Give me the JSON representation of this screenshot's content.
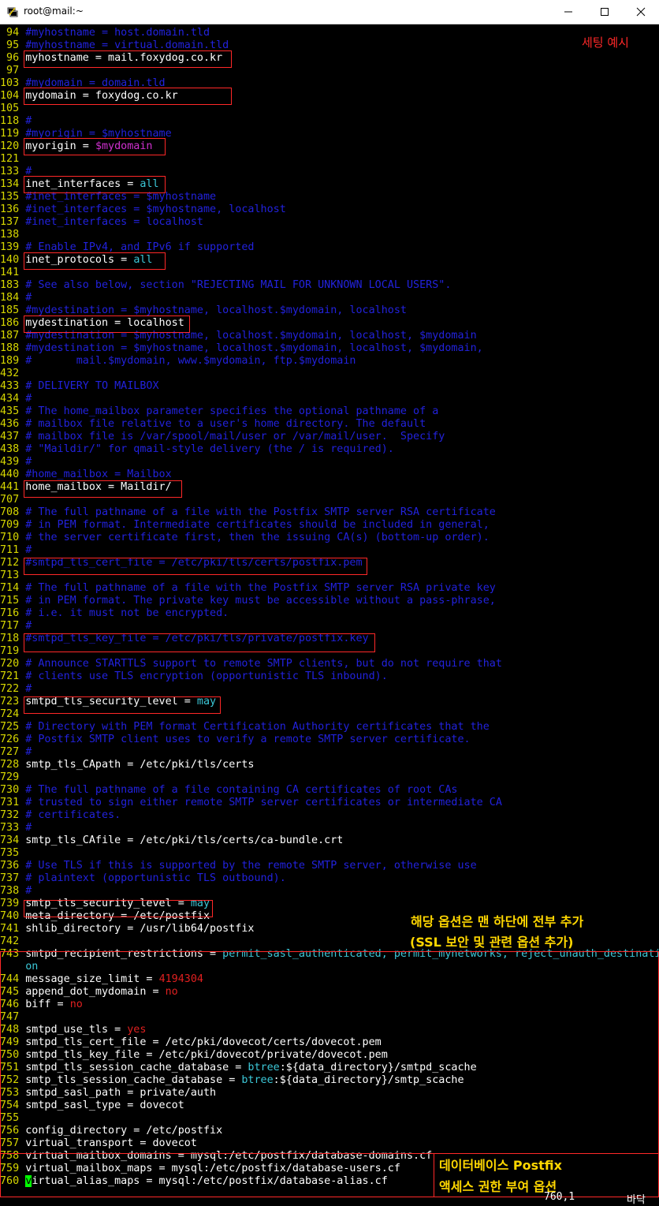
{
  "window": {
    "title": "root@mail:~",
    "icon": "putty-terminal-icon",
    "controls": [
      "minimize",
      "maximize",
      "close"
    ]
  },
  "colors": {
    "line_number": "#d7d700",
    "normal": "#ffffff",
    "comment": "#2222dd",
    "value": "#3cc8d8",
    "variable": "#d030d0",
    "number": "#e02020",
    "annotation_red": "#ff2828",
    "annotation_yellow": "#ffd700"
  },
  "lines": [
    {
      "n": "94",
      "s": [
        [
          "comment",
          "#myhostname = host.domain.tld"
        ]
      ]
    },
    {
      "n": "95",
      "s": [
        [
          "comment",
          "#myhostname = virtual.domain.tld"
        ]
      ]
    },
    {
      "n": "96",
      "s": [
        [
          "normal",
          "myhostname = mail.foxydog.co.kr"
        ]
      ]
    },
    {
      "n": "97",
      "s": []
    },
    {
      "n": "103",
      "s": [
        [
          "comment",
          "#mydomain = domain.tld"
        ]
      ]
    },
    {
      "n": "104",
      "s": [
        [
          "normal",
          "mydomain = foxydog.co.kr"
        ]
      ]
    },
    {
      "n": "105",
      "s": []
    },
    {
      "n": "118",
      "s": [
        [
          "comment",
          "#"
        ]
      ]
    },
    {
      "n": "119",
      "s": [
        [
          "comment",
          "#myorigin = $myhostname"
        ]
      ]
    },
    {
      "n": "120",
      "s": [
        [
          "normal",
          "myorigin = "
        ],
        [
          "var",
          "$mydomain"
        ]
      ]
    },
    {
      "n": "121",
      "s": []
    },
    {
      "n": "133",
      "s": [
        [
          "comment",
          "#"
        ]
      ]
    },
    {
      "n": "134",
      "s": [
        [
          "normal",
          "inet_interfaces = "
        ],
        [
          "value",
          "all"
        ]
      ]
    },
    {
      "n": "135",
      "s": [
        [
          "comment",
          "#inet_interfaces = $myhostname"
        ]
      ]
    },
    {
      "n": "136",
      "s": [
        [
          "comment",
          "#inet_interfaces = $myhostname, localhost"
        ]
      ]
    },
    {
      "n": "137",
      "s": [
        [
          "comment",
          "#inet_interfaces = localhost"
        ]
      ]
    },
    {
      "n": "138",
      "s": []
    },
    {
      "n": "139",
      "s": [
        [
          "comment",
          "# Enable IPv4, and IPv6 if supported"
        ]
      ]
    },
    {
      "n": "140",
      "s": [
        [
          "normal",
          "inet_protocols = "
        ],
        [
          "value",
          "all"
        ]
      ]
    },
    {
      "n": "141",
      "s": []
    },
    {
      "n": "183",
      "s": [
        [
          "comment",
          "# See also below, section \"REJECTING MAIL FOR UNKNOWN LOCAL USERS\"."
        ]
      ]
    },
    {
      "n": "184",
      "s": [
        [
          "comment",
          "#"
        ]
      ]
    },
    {
      "n": "185",
      "s": [
        [
          "comment",
          "#mydestination = $myhostname, localhost.$mydomain, localhost"
        ]
      ]
    },
    {
      "n": "186",
      "s": [
        [
          "normal",
          "mydestination = localhost"
        ]
      ]
    },
    {
      "n": "187",
      "s": [
        [
          "comment",
          "#mydestination = $myhostname, localhost.$mydomain, localhost, $mydomain"
        ]
      ]
    },
    {
      "n": "188",
      "s": [
        [
          "comment",
          "#mydestination = $myhostname, localhost.$mydomain, localhost, $mydomain,"
        ]
      ]
    },
    {
      "n": "189",
      "s": [
        [
          "comment",
          "#       mail.$mydomain, www.$mydomain, ftp.$mydomain"
        ]
      ]
    },
    {
      "n": "432",
      "s": []
    },
    {
      "n": "433",
      "s": [
        [
          "comment",
          "# DELIVERY TO MAILBOX"
        ]
      ]
    },
    {
      "n": "434",
      "s": [
        [
          "comment",
          "#"
        ]
      ]
    },
    {
      "n": "435",
      "s": [
        [
          "comment",
          "# The home_mailbox parameter specifies the optional pathname of a"
        ]
      ]
    },
    {
      "n": "436",
      "s": [
        [
          "comment",
          "# mailbox file relative to a user's home directory. The default"
        ]
      ]
    },
    {
      "n": "437",
      "s": [
        [
          "comment",
          "# mailbox file is /var/spool/mail/user or /var/mail/user.  Specify"
        ]
      ]
    },
    {
      "n": "438",
      "s": [
        [
          "comment",
          "# \"Maildir/\" for qmail-style delivery (the / is required)."
        ]
      ]
    },
    {
      "n": "439",
      "s": [
        [
          "comment",
          "#"
        ]
      ]
    },
    {
      "n": "440",
      "s": [
        [
          "comment",
          "#home_mailbox = Mailbox"
        ]
      ]
    },
    {
      "n": "441",
      "s": [
        [
          "normal",
          "home_mailbox = Maildir/"
        ]
      ]
    },
    {
      "n": "707",
      "s": []
    },
    {
      "n": "708",
      "s": [
        [
          "comment",
          "# The full pathname of a file with the Postfix SMTP server RSA certificate"
        ]
      ]
    },
    {
      "n": "709",
      "s": [
        [
          "comment",
          "# in PEM format. Intermediate certificates should be included in general,"
        ]
      ]
    },
    {
      "n": "710",
      "s": [
        [
          "comment",
          "# the server certificate first, then the issuing CA(s) (bottom-up order)."
        ]
      ]
    },
    {
      "n": "711",
      "s": [
        [
          "comment",
          "#"
        ]
      ]
    },
    {
      "n": "712",
      "s": [
        [
          "comment",
          "#smtpd_tls_cert_file = /etc/pki/tls/certs/postfix.pem"
        ]
      ]
    },
    {
      "n": "713",
      "s": []
    },
    {
      "n": "714",
      "s": [
        [
          "comment",
          "# The full pathname of a file with the Postfix SMTP server RSA private key"
        ]
      ]
    },
    {
      "n": "715",
      "s": [
        [
          "comment",
          "# in PEM format. The private key must be accessible without a pass-phrase,"
        ]
      ]
    },
    {
      "n": "716",
      "s": [
        [
          "comment",
          "# i.e. it must not be encrypted."
        ]
      ]
    },
    {
      "n": "717",
      "s": [
        [
          "comment",
          "#"
        ]
      ]
    },
    {
      "n": "718",
      "s": [
        [
          "comment",
          "#smtpd_tls_key_file = /etc/pki/tls/private/postfix.key"
        ]
      ]
    },
    {
      "n": "719",
      "s": []
    },
    {
      "n": "720",
      "s": [
        [
          "comment",
          "# Announce STARTTLS support to remote SMTP clients, but do not require that"
        ]
      ]
    },
    {
      "n": "721",
      "s": [
        [
          "comment",
          "# clients use TLS encryption (opportunistic TLS inbound)."
        ]
      ]
    },
    {
      "n": "722",
      "s": [
        [
          "comment",
          "#"
        ]
      ]
    },
    {
      "n": "723",
      "s": [
        [
          "normal",
          "smtpd_tls_security_level = "
        ],
        [
          "value",
          "may"
        ]
      ]
    },
    {
      "n": "724",
      "s": []
    },
    {
      "n": "725",
      "s": [
        [
          "comment",
          "# Directory with PEM format Certification Authority certificates that the"
        ]
      ]
    },
    {
      "n": "726",
      "s": [
        [
          "comment",
          "# Postfix SMTP client uses to verify a remote SMTP server certificate."
        ]
      ]
    },
    {
      "n": "727",
      "s": [
        [
          "comment",
          "#"
        ]
      ]
    },
    {
      "n": "728",
      "s": [
        [
          "normal",
          "smtp_tls_CApath = /etc/pki/tls/certs"
        ]
      ]
    },
    {
      "n": "729",
      "s": []
    },
    {
      "n": "730",
      "s": [
        [
          "comment",
          "# The full pathname of a file containing CA certificates of root CAs"
        ]
      ]
    },
    {
      "n": "731",
      "s": [
        [
          "comment",
          "# trusted to sign either remote SMTP server certificates or intermediate CA"
        ]
      ]
    },
    {
      "n": "732",
      "s": [
        [
          "comment",
          "# certificates."
        ]
      ]
    },
    {
      "n": "733",
      "s": [
        [
          "comment",
          "#"
        ]
      ]
    },
    {
      "n": "734",
      "s": [
        [
          "normal",
          "smtp_tls_CAfile = /etc/pki/tls/certs/ca-bundle.crt"
        ]
      ]
    },
    {
      "n": "735",
      "s": []
    },
    {
      "n": "736",
      "s": [
        [
          "comment",
          "# Use TLS if this is supported by the remote SMTP server, otherwise use"
        ]
      ]
    },
    {
      "n": "737",
      "s": [
        [
          "comment",
          "# plaintext (opportunistic TLS outbound)."
        ]
      ]
    },
    {
      "n": "738",
      "s": [
        [
          "comment",
          "#"
        ]
      ]
    },
    {
      "n": "739",
      "s": [
        [
          "normal",
          "smtp_tls_security_level = "
        ],
        [
          "value",
          "may"
        ]
      ]
    },
    {
      "n": "740",
      "s": [
        [
          "normal",
          "meta_directory = /etc/postfix"
        ]
      ]
    },
    {
      "n": "741",
      "s": [
        [
          "normal",
          "shlib_directory = /usr/lib64/postfix"
        ]
      ]
    },
    {
      "n": "742",
      "s": []
    },
    {
      "n": "743",
      "s": [
        [
          "normal",
          "smtpd_recipient_restrictions = "
        ],
        [
          "value",
          "permit_sasl_authenticated, permit_mynetworks, reject_unauth_destinati"
        ]
      ]
    },
    {
      "n": "",
      "s": [
        [
          "value",
          "on"
        ]
      ]
    },
    {
      "n": "744",
      "s": [
        [
          "normal",
          "message_size_limit = "
        ],
        [
          "num",
          "4194304"
        ]
      ]
    },
    {
      "n": "745",
      "s": [
        [
          "normal",
          "append_dot_mydomain = "
        ],
        [
          "num",
          "no"
        ]
      ]
    },
    {
      "n": "746",
      "s": [
        [
          "normal",
          "biff = "
        ],
        [
          "num",
          "no"
        ]
      ]
    },
    {
      "n": "747",
      "s": []
    },
    {
      "n": "748",
      "s": [
        [
          "normal",
          "smtpd_use_tls = "
        ],
        [
          "num",
          "yes"
        ]
      ]
    },
    {
      "n": "749",
      "s": [
        [
          "normal",
          "smtpd_tls_cert_file = /etc/pki/dovecot/certs/dovecot.pem"
        ]
      ]
    },
    {
      "n": "750",
      "s": [
        [
          "normal",
          "smtpd_tls_key_file = /etc/pki/dovecot/private/dovecot.pem"
        ]
      ]
    },
    {
      "n": "751",
      "s": [
        [
          "normal",
          "smtpd_tls_session_cache_database = "
        ],
        [
          "value",
          "btree"
        ],
        [
          "normal",
          ":${data_directory}/smtpd_scache"
        ]
      ]
    },
    {
      "n": "752",
      "s": [
        [
          "normal",
          "smtp_tls_session_cache_database = "
        ],
        [
          "value",
          "btree"
        ],
        [
          "normal",
          ":${data_directory}/smtp_scache"
        ]
      ]
    },
    {
      "n": "753",
      "s": [
        [
          "normal",
          "smtpd_sasl_path = private/auth"
        ]
      ]
    },
    {
      "n": "754",
      "s": [
        [
          "normal",
          "smtpd_sasl_type = dovecot"
        ]
      ]
    },
    {
      "n": "755",
      "s": []
    },
    {
      "n": "756",
      "s": [
        [
          "normal",
          "config_directory = /etc/postfix"
        ]
      ]
    },
    {
      "n": "757",
      "s": [
        [
          "normal",
          "virtual_transport = dovecot"
        ]
      ]
    },
    {
      "n": "758",
      "s": [
        [
          "normal",
          "virtual_mailbox_domains = mysql:/etc/postfix/database-domains.cf"
        ]
      ]
    },
    {
      "n": "759",
      "s": [
        [
          "normal",
          "virtual_mailbox_maps = mysql:/etc/postfix/database-users.cf"
        ]
      ]
    },
    {
      "n": "760",
      "s": [
        [
          "cursor",
          "v"
        ],
        [
          "normal",
          "irtual_alias_maps = mysql:/etc/postfix/database-alias.cf"
        ]
      ]
    }
  ],
  "annotations": {
    "setting_example": "세팅 예시",
    "append_note_line1": "해당 옵션은 맨 하단에 전부 추가",
    "append_note_line2": "(SSL 보안 및 관련 옵션 추가)",
    "db_note_line1": "데이터베이스 Postfix",
    "db_note_line2": "액세스 권한 부여 옵션"
  },
  "status_bar": {
    "position": "760,1",
    "scroll": "바닥"
  }
}
